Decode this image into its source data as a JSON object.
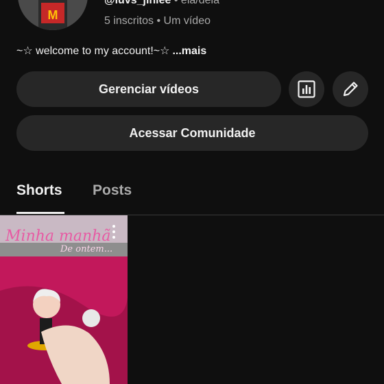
{
  "channel": {
    "handle": "@luvs_jinlee",
    "pronouns": " • ela/dela",
    "stats": "5 inscritos • Um vídeo",
    "bio": "~☆ welcome to my account!~☆",
    "bio_more": "...mais"
  },
  "actions": {
    "manage_videos": "Gerenciar vídeos",
    "community": "Acessar Comunidade",
    "analytics_icon": "bar-chart-icon",
    "edit_icon": "pencil-icon"
  },
  "tabs": [
    {
      "label": "Shorts",
      "active": true
    },
    {
      "label": "Posts",
      "active": false
    }
  ],
  "shorts": [
    {
      "overlay_title": "Minha manhã",
      "overlay_subtitle": "De ontem..."
    }
  ],
  "colors": {
    "background": "#0f0f0f",
    "pill": "#272727",
    "text_primary": "#f1f1f1",
    "text_secondary": "#aaaaaa",
    "thumb_overlay": "#e75aa3"
  }
}
